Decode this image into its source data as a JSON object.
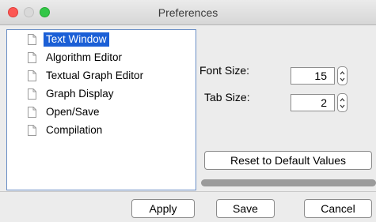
{
  "window": {
    "title": "Preferences"
  },
  "tree": {
    "items": [
      {
        "label": "Text Window",
        "selected": true
      },
      {
        "label": "Algorithm Editor",
        "selected": false
      },
      {
        "label": "Textual Graph Editor",
        "selected": false
      },
      {
        "label": "Graph Display",
        "selected": false
      },
      {
        "label": "Open/Save",
        "selected": false
      },
      {
        "label": "Compilation",
        "selected": false
      }
    ]
  },
  "settings": {
    "font_size_label": "Font Size:",
    "font_size_value": "15",
    "tab_size_label": "Tab Size:",
    "tab_size_value": "2",
    "reset_label": "Reset to Default Values"
  },
  "footer": {
    "apply_label": "Apply",
    "save_label": "Save",
    "cancel_label": "Cancel"
  },
  "colors": {
    "selection": "#1b5fd6",
    "tree_border": "#6b8fc6",
    "close": "#fc5753",
    "maximize": "#33c748"
  }
}
